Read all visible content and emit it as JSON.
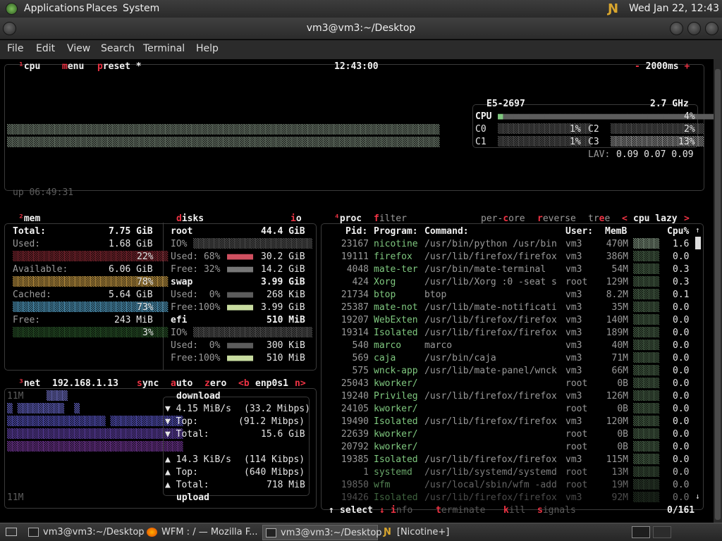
{
  "top_panel": {
    "menus": [
      "Applications",
      "Places",
      "System"
    ],
    "clock": "Wed Jan 22, 12:43 PM"
  },
  "window": {
    "title": "vm3@vm3:~/Desktop"
  },
  "menubar": [
    "File",
    "Edit",
    "View",
    "Search",
    "Terminal",
    "Help"
  ],
  "cpu_box": {
    "num": "¹",
    "label": "cpu",
    "menu": "menu",
    "preset": "preset *",
    "time": "12:43:00",
    "interval": "2000ms",
    "uptime": "up 06:49:31",
    "model": "E5-2697",
    "freq": "2.7 GHz",
    "cpu_total": "4%",
    "cores": [
      {
        "name": "C0",
        "pct": "1%"
      },
      {
        "name": "C1",
        "pct": "1%"
      },
      {
        "name": "C2",
        "pct": "2%"
      },
      {
        "name": "C3",
        "pct": "13%"
      }
    ],
    "lav_label": "LAV:",
    "lav": "0.09 0.07 0.09"
  },
  "mem_box": {
    "num": "²",
    "label": "mem",
    "total_label": "Total:",
    "total": "7.75 GiB",
    "used_label": "Used:",
    "used": "1.68 GiB",
    "used_pct": "22%",
    "avail_label": "Available:",
    "avail": "6.06 GiB",
    "avail_pct": "78%",
    "cached_label": "Cached:",
    "cached": "5.64 GiB",
    "cached_pct": "73%",
    "free_label": "Free:",
    "free": "243 MiB",
    "free_pct": "3%"
  },
  "disks_box": {
    "label": "disks",
    "io": "io",
    "root": {
      "name": "root",
      "size": "44.4 GiB",
      "io": "IO%",
      "used_label": "Used: 68%",
      "used": "30.2 GiB",
      "free_label": "Free: 32%",
      "free": "14.2 GiB"
    },
    "swap": {
      "name": "swap",
      "size": "3.99 GiB",
      "used_label": "Used:  0%",
      "used": "268 KiB",
      "free_label": "Free:100%",
      "free": "3.99 GiB"
    },
    "efi": {
      "name": "efi",
      "size": "510 MiB",
      "io": "IO%",
      "used_label": "Used:  0%",
      "used": "300 KiB",
      "free_label": "Free:100%",
      "free": "510 MiB"
    }
  },
  "net_box": {
    "num": "³",
    "label": "net",
    "ip": "192.168.1.13",
    "sync": "sync",
    "auto": "auto",
    "zero": "zero",
    "iface_prev": "<b",
    "iface": "enp0s1",
    "iface_next": "n>",
    "scale_top": "11M",
    "scale_bottom": "11M",
    "download_label": "download",
    "upload_label": "upload",
    "dl_rate": "4.15 MiB/s",
    "dl_mbps": "(33.2 Mibps)",
    "dl_top_label": "Top:",
    "dl_top": "(91.2 Mibps)",
    "dl_total_label": "Total:",
    "dl_total": "15.6 GiB",
    "ul_rate": "14.3 KiB/s",
    "ul_mbps": "(114 Kibps)",
    "ul_top_label": "Top:",
    "ul_top": "(640 Mibps)",
    "ul_total_label": "Total:",
    "ul_total": "718 MiB"
  },
  "proc_box": {
    "num": "⁴",
    "label": "proc",
    "filter": "filter",
    "per_core": "per-core",
    "reverse": "reverse",
    "tree": "tree",
    "sort_prev": "<",
    "sort": "cpu lazy",
    "sort_next": ">",
    "headers": [
      "Pid:",
      "Program:",
      "Command:",
      "User:",
      "MemB",
      "Cpu%"
    ],
    "rows": [
      [
        "23167",
        "nicotine",
        "/usr/bin/python /usr/bin",
        "vm3",
        "470M",
        "1.6"
      ],
      [
        "19111",
        "firefox",
        "/usr/lib/firefox/firefox",
        "vm3",
        "386M",
        "0.0"
      ],
      [
        "4048",
        "mate-ter",
        "/usr/bin/mate-terminal",
        "vm3",
        "54M",
        "0.3"
      ],
      [
        "424",
        "Xorg",
        "/usr/lib/Xorg :0 -seat s",
        "root",
        "129M",
        "0.3"
      ],
      [
        "21734",
        "btop",
        "btop",
        "vm3",
        "8.2M",
        "0.1"
      ],
      [
        "25387",
        "mate-not",
        "/usr/lib/mate-notificati",
        "vm3",
        "35M",
        "0.0"
      ],
      [
        "19207",
        "WebExten",
        "/usr/lib/firefox/firefox",
        "vm3",
        "140M",
        "0.0"
      ],
      [
        "19314",
        "Isolated",
        "/usr/lib/firefox/firefox",
        "vm3",
        "189M",
        "0.0"
      ],
      [
        "540",
        "marco",
        "marco",
        "vm3",
        "40M",
        "0.0"
      ],
      [
        "569",
        "caja",
        "/usr/bin/caja",
        "vm3",
        "71M",
        "0.0"
      ],
      [
        "575",
        "wnck-app",
        "/usr/lib/mate-panel/wnck",
        "vm3",
        "66M",
        "0.0"
      ],
      [
        "25043",
        "kworker/",
        "",
        "root",
        "0B",
        "0.0"
      ],
      [
        "19240",
        "Privileg",
        "/usr/lib/firefox/firefox",
        "vm3",
        "126M",
        "0.0"
      ],
      [
        "24105",
        "kworker/",
        "",
        "root",
        "0B",
        "0.0"
      ],
      [
        "19490",
        "Isolated",
        "/usr/lib/firefox/firefox",
        "vm3",
        "120M",
        "0.0"
      ],
      [
        "22639",
        "kworker/",
        "",
        "root",
        "0B",
        "0.0"
      ],
      [
        "20792",
        "kworker/",
        "",
        "root",
        "0B",
        "0.0"
      ],
      [
        "19385",
        "Isolated",
        "/usr/lib/firefox/firefox",
        "vm3",
        "115M",
        "0.0"
      ],
      [
        "1",
        "systemd",
        "/usr/lib/systemd/systemd",
        "root",
        "13M",
        "0.0"
      ],
      [
        "19850",
        "wfm",
        "/usr/local/sbin/wfm -add",
        "root",
        "19M",
        "0.0"
      ],
      [
        "19426",
        "Isolated",
        "/usr/lib/firefox/firefox",
        "vm3",
        "92M",
        "0.0"
      ]
    ],
    "footer": {
      "select": "select",
      "info": "info",
      "terminate": "terminate",
      "kill": "kill",
      "signals": "signals",
      "count": "0/161"
    }
  },
  "taskbar": {
    "tasks": [
      "vm3@vm3:~/Desktop",
      "WFM : / — Mozilla F...",
      "vm3@vm3:~/Desktop",
      "[Nicotine+]"
    ]
  },
  "colors": {
    "accent_red": "#ee3344",
    "text": "#e6e6e6",
    "dim": "#7a7a7a",
    "green": "#7fc87f"
  }
}
